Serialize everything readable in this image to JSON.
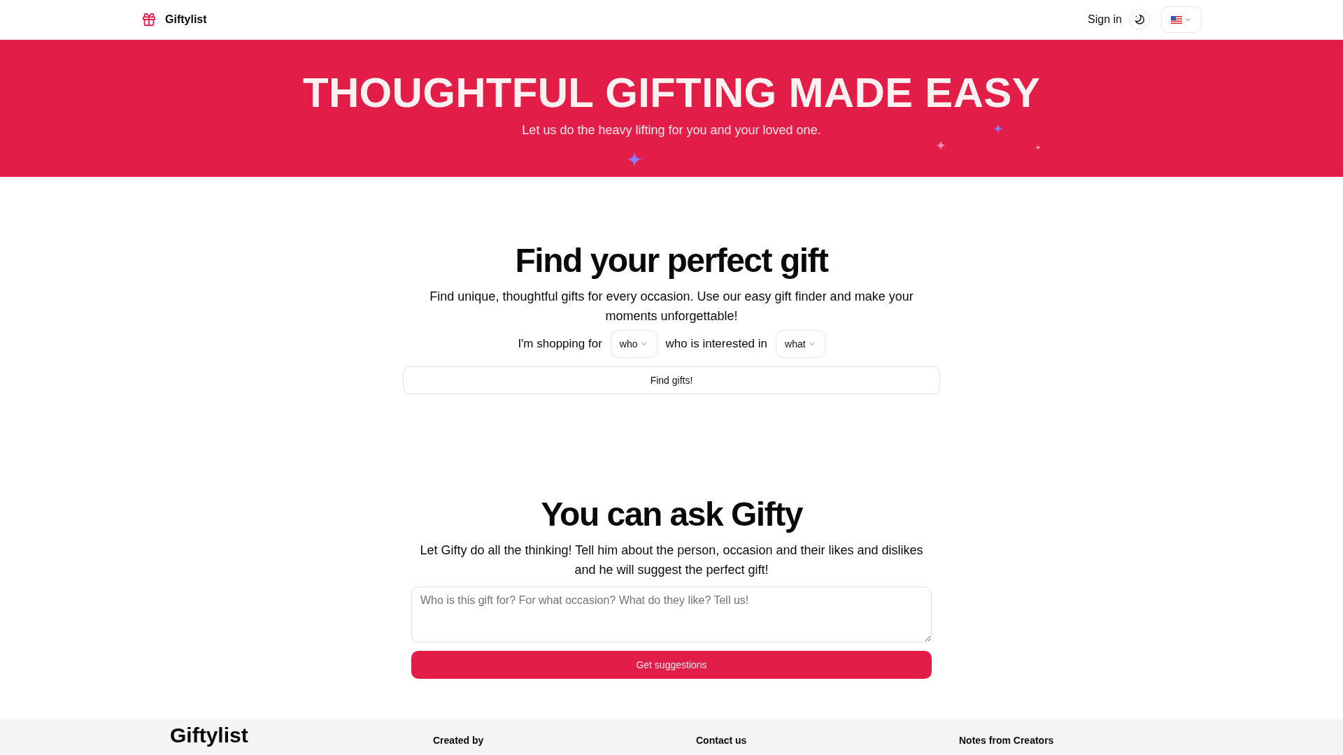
{
  "header": {
    "brand": "Giftylist",
    "sign_in": "Sign in"
  },
  "hero": {
    "title": "THOUGHTFUL GIFTING MADE EASY",
    "subtitle": "Let us do the heavy lifting for you and your loved one."
  },
  "finder": {
    "title": "Find your perfect gift",
    "description": "Find unique, thoughtful gifts for every occasion. Use our easy gift finder and make your moments unforgettable!",
    "prefix": "I'm shopping for",
    "who": "who",
    "middle": "who is interested in",
    "what": "what",
    "button": "Find gifts!"
  },
  "ask": {
    "title": "You can ask Gifty",
    "description": "Let Gifty do all the thinking! Tell him about the person, occasion and their likes and dislikes and he will suggest the perfect gift!",
    "placeholder": "Who is this gift for? For what occasion? What do they like? Tell us!",
    "button": "Get suggestions"
  },
  "footer": {
    "brand": "Giftylist",
    "columns": [
      "Created by",
      "Contact us",
      "Notes from Creators"
    ]
  }
}
